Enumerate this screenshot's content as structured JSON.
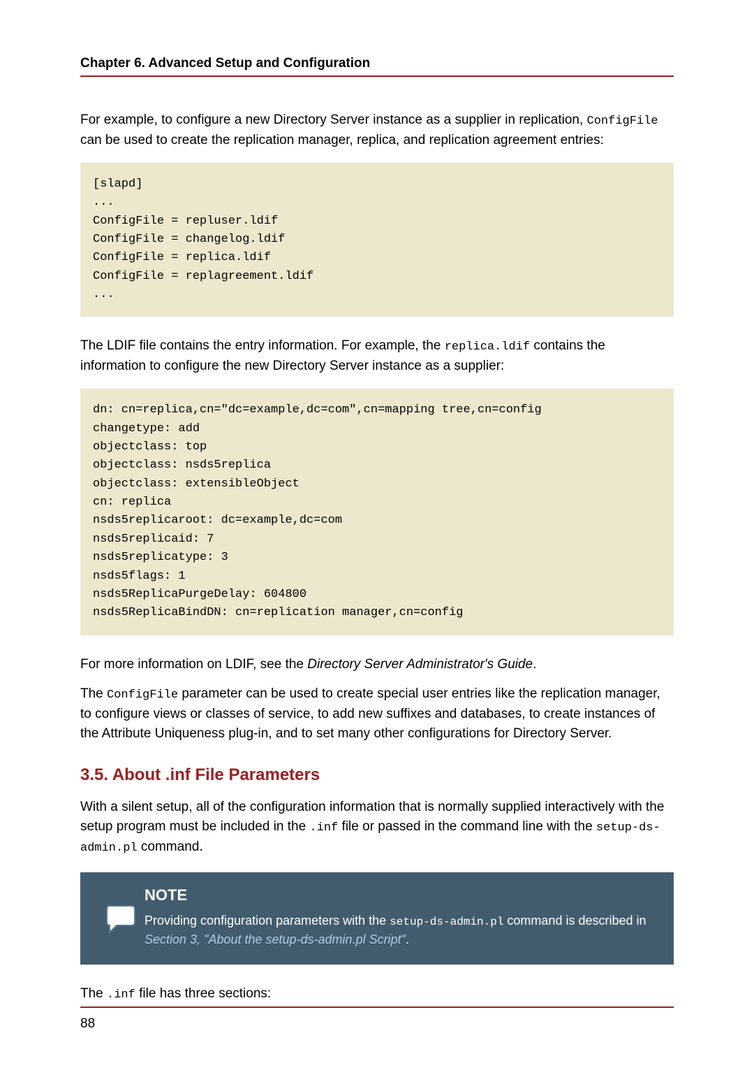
{
  "header": {
    "chapter": "Chapter 6. Advanced Setup and Configuration"
  },
  "intro": {
    "p1_a": "For example, to configure a new Directory Server instance as a supplier in replication, ",
    "p1_code": "ConfigFile",
    "p1_b": " can be used to create the replication manager, replica, and replication agreement entries:"
  },
  "code1": "[slapd]\n...\nConfigFile = repluser.ldif\nConfigFile = changelog.ldif\nConfigFile = replica.ldif\nConfigFile = replagreement.ldif\n...",
  "mid": {
    "p2_a": "The LDIF file contains the entry information. For example, the ",
    "p2_code": "replica.ldif",
    "p2_b": " contains the information to configure the new Directory Server instance as a supplier:"
  },
  "code2": "dn: cn=replica,cn=\"dc=example,dc=com\",cn=mapping tree,cn=config\nchangetype: add\nobjectclass: top\nobjectclass: nsds5replica\nobjectclass: extensibleObject\ncn: replica\nnsds5replicaroot: dc=example,dc=com\nnsds5replicaid: 7\nnsds5replicatype: 3\nnsds5flags: 1\nnsds5ReplicaPurgeDelay: 604800\nnsds5ReplicaBindDN: cn=replication manager,cn=config",
  "after": {
    "p3_a": "For more information on LDIF, see the ",
    "p3_em": "Directory Server Administrator's Guide",
    "p3_b": ".",
    "p4_a": "The ",
    "p4_code": "ConfigFile",
    "p4_b": " parameter can be used to create special user entries like the replication manager, to configure views or classes of service, to add new suffixes and databases, to create instances of the Attribute Uniqueness plug-in, and to set many other configurations for Directory Server."
  },
  "section": {
    "heading": "3.5. About .inf File Parameters",
    "p5_a": "With a silent setup, all of the configuration information that is normally supplied interactively with the setup program must be included in the ",
    "p5_code1": ".inf",
    "p5_b": " file or passed in the command line with the ",
    "p5_code2": "setup-ds-admin.pl",
    "p5_c": " command."
  },
  "note": {
    "title": "NOTE",
    "text_a": "Providing configuration parameters with the ",
    "text_code": "setup-ds-admin.pl",
    "text_b": " command is described in ",
    "link": "Section 3, \"About the setup-ds-admin.pl Script\"",
    "text_c": "."
  },
  "tail": {
    "p6_a": "The ",
    "p6_code": ".inf",
    "p6_b": " file has three sections:"
  },
  "page_number": "88"
}
